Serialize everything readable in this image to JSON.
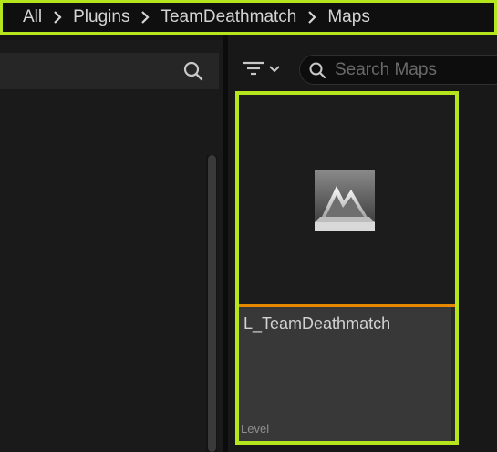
{
  "breadcrumb": {
    "items": [
      "All",
      "Plugins",
      "TeamDeathmatch",
      "Maps"
    ]
  },
  "icons": {
    "left_search": "search-icon",
    "filter": "filter-icon",
    "right_search": "search-icon",
    "separator": "chevron-right-icon",
    "asset": "level-map-icon"
  },
  "right_panel": {
    "search_placeholder": "Search Maps",
    "search_value": ""
  },
  "asset": {
    "name": "L_TeamDeathmatch",
    "type": "Level"
  },
  "colors": {
    "highlight": "#b5e61d",
    "asset_type_bar": "#e58a00",
    "background": "#151515"
  }
}
